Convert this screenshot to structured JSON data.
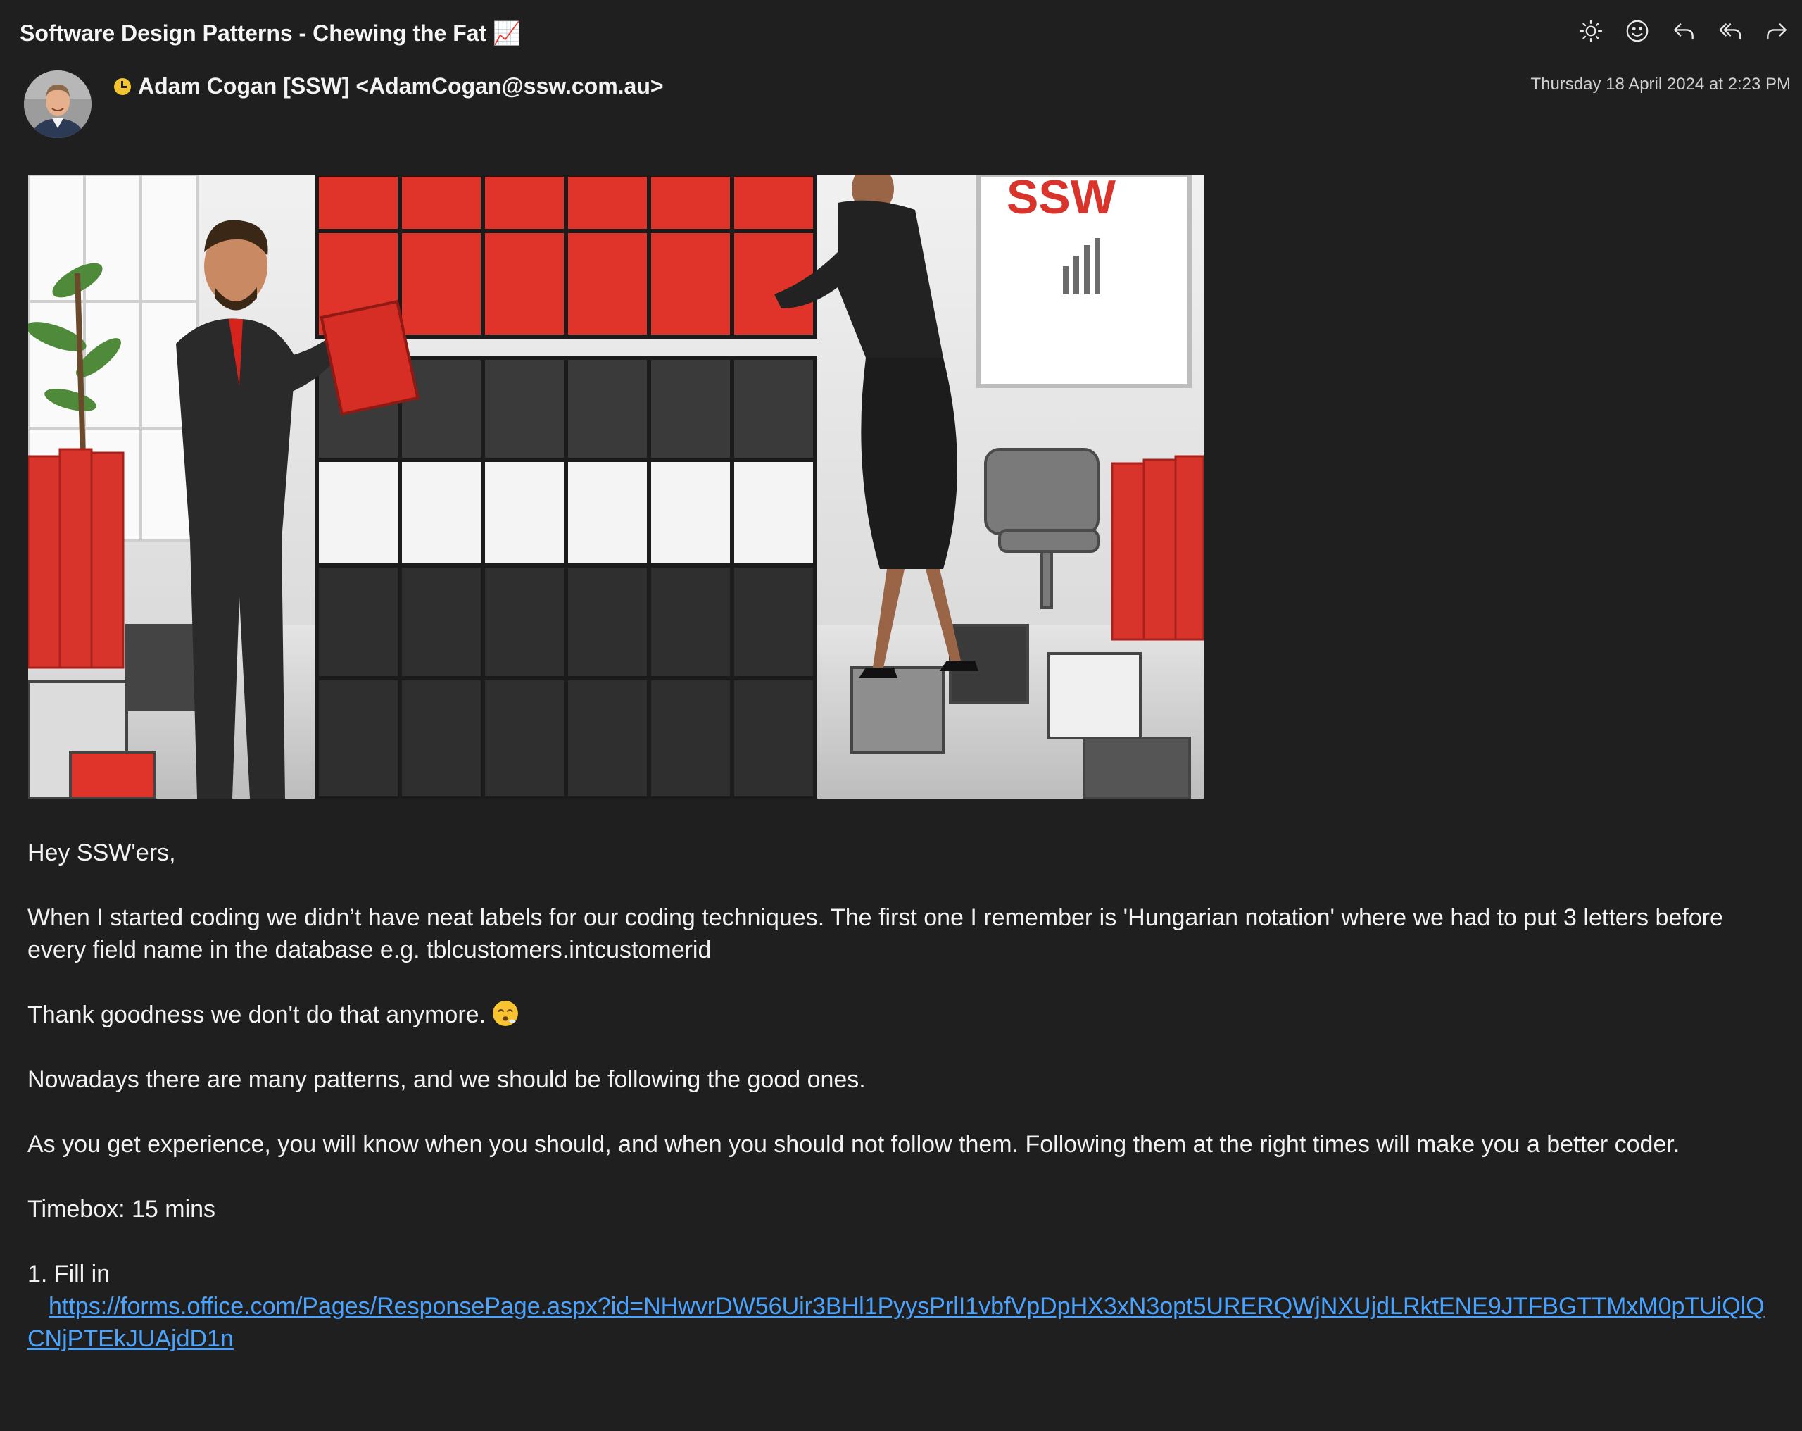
{
  "email": {
    "subject": "Software Design Patterns - Chewing the Fat 📈",
    "sender": "Adam Cogan [SSW] <AdamCogan@ssw.com.au>",
    "date": "Thursday 18 April 2024 at 2:23 PM",
    "hero_image": {
      "alt": "People building a red, white and black block cube in an office",
      "sign_text": "SSW"
    }
  },
  "toolbar": {
    "items": [
      {
        "name": "brightness-icon"
      },
      {
        "name": "emoji-reaction-icon"
      },
      {
        "name": "reply-icon"
      },
      {
        "name": "reply-all-icon"
      },
      {
        "name": "forward-icon"
      }
    ]
  },
  "body": {
    "greeting": "Hey SSW'ers,",
    "para1": "When I started coding we didn’t have neat labels for our coding techniques. The first one I remember is 'Hungarian notation' where we had to put 3 letters before every field name in the database e.g. tblcustomers.intcustomerid",
    "para2": "Thank goodness we don't do that anymore.",
    "para3": "Nowadays there are many patterns, and we should be following the good ones.",
    "para4": "As you get experience, you will know when you should, and when you should not follow them. Following them at the right times will make you a better coder.",
    "timebox": "Timebox: 15 mins",
    "step1_label": "1. Fill in",
    "step1_link": "https://forms.office.com/Pages/ResponsePage.aspx?id=NHwvrDW56Uir3BHl1PyysPrlI1vbfVpDpHX3xN3opt5URERQWjNXUjdLRktENE9JTFBGTTMxM0pTUiQlQCNjPTEkJUAjdD1n"
  },
  "colors": {
    "background": "#1f1f1f",
    "text": "#f2f2f2",
    "link": "#4aa3ff",
    "status": "#f2c530"
  }
}
